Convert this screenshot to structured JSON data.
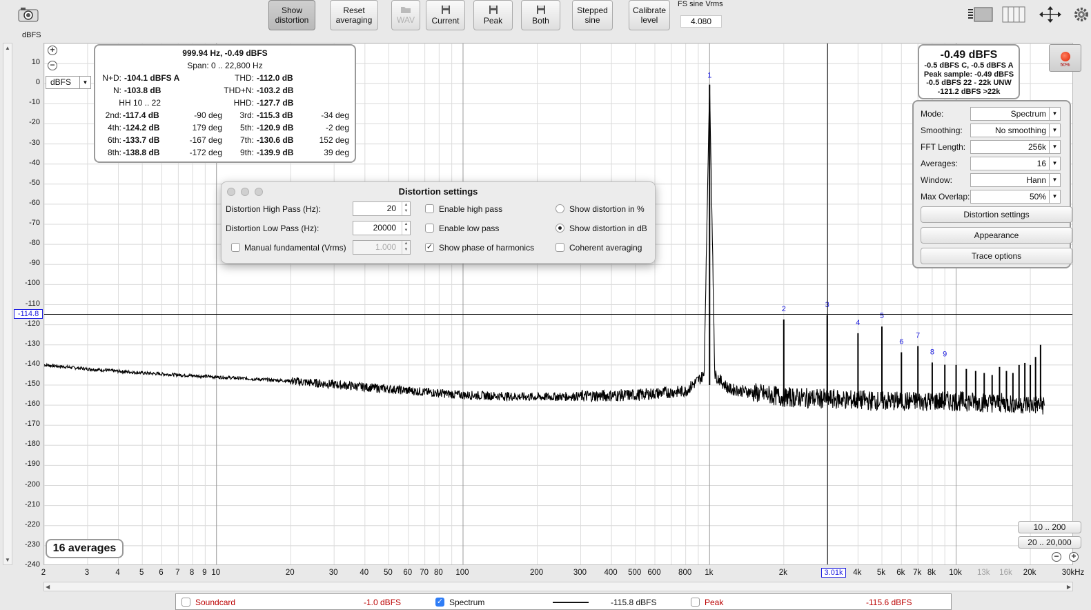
{
  "toolbar": {
    "show_distortion": "Show\ndistortion",
    "reset_averaging": "Reset\naveraging",
    "wav": "WAV",
    "current": "Current",
    "peak": "Peak",
    "both": "Both",
    "stepped_sine": "Stepped\nsine",
    "calibrate_level": "Calibrate\nlevel",
    "fs_sine_label": "FS sine Vrms",
    "fs_sine_value": "4.080"
  },
  "axis": {
    "y_unit": "dBFS",
    "y_ticks": [
      "10",
      "0",
      "-10",
      "-20",
      "-30",
      "-40",
      "-50",
      "-60",
      "-70",
      "-80",
      "-90",
      "-100",
      "-110",
      "-120",
      "-130",
      "-140",
      "-150",
      "-160",
      "-170",
      "-180",
      "-190",
      "-200",
      "-210",
      "-220",
      "-230",
      "-240"
    ],
    "x_ticks": [
      "2",
      "3",
      "4",
      "5",
      "6",
      "7",
      "8",
      "9",
      "10",
      "20",
      "30",
      "40",
      "50",
      "60",
      "70",
      "80",
      "100",
      "200",
      "300",
      "400",
      "500",
      "600",
      "800",
      "1k",
      "2k",
      "4k",
      "5k",
      "6k",
      "7k",
      "8k",
      "10k",
      "13k",
      "16k",
      "20k",
      "30kHz"
    ],
    "x_ticks_grey": [
      "13k",
      "16k"
    ],
    "cursor_y": "-114.8",
    "cursor_x": "3.01k",
    "dbfs_select": "dBFS"
  },
  "info": {
    "header": "999.94 Hz, -0.49 dBFS",
    "span": "Span: 0 .. 22,800 Hz",
    "rows": [
      {
        "l": "N+D:",
        "lv": "-104.1 dBFS A",
        "r": "THD:",
        "rv": "-112.0 dB"
      },
      {
        "l": "N:",
        "lv": "-103.8 dB",
        "r": "THD+N:",
        "rv": "-103.2 dB"
      },
      {
        "l": "HH 10 .. 22",
        "lv": "",
        "r": "HHD:",
        "rv": "-127.7 dB"
      }
    ],
    "harmonics": [
      {
        "n": "2nd:",
        "v": "-117.4 dB",
        "p": "-90 deg",
        "n2": "3rd:",
        "v2": "-115.3 dB",
        "p2": "-34 deg"
      },
      {
        "n": "4th:",
        "v": "-124.2 dB",
        "p": "179 deg",
        "n2": "5th:",
        "v2": "-120.9 dB",
        "p2": "-2 deg"
      },
      {
        "n": "6th:",
        "v": "-133.7 dB",
        "p": "-167 deg",
        "n2": "7th:",
        "v2": "-130.6 dB",
        "p2": "152 deg"
      },
      {
        "n": "8th:",
        "v": "-138.8 dB",
        "p": "-172 deg",
        "n2": "9th:",
        "v2": "-139.9 dB",
        "p2": "39 deg"
      }
    ]
  },
  "dialog": {
    "title": "Distortion settings",
    "hp_label": "Distortion High Pass (Hz):",
    "hp_value": "20",
    "lp_label": "Distortion Low Pass (Hz):",
    "lp_value": "20000",
    "manual_label": "Manual fundamental (Vrms)",
    "manual_value": "1.000",
    "manual_checked": false,
    "enable_hp": "Enable high pass",
    "enable_hp_checked": false,
    "enable_lp": "Enable low pass",
    "enable_lp_checked": false,
    "show_phase": "Show phase of harmonics",
    "show_phase_checked": true,
    "show_pct": "Show distortion in %",
    "show_db": "Show distortion in dB",
    "distortion_unit": "dB",
    "coherent": "Coherent averaging",
    "coherent_checked": false
  },
  "level": {
    "main": "-0.49 dBFS",
    "lines": [
      "-0.5 dBFS C, -0.5 dBFS A",
      "Peak sample: -0.49 dBFS",
      "-0.5 dBFS 22 - 22k UNW",
      "-121.2 dBFS >22k"
    ],
    "rec_pct": "50%"
  },
  "settings": {
    "rows": [
      {
        "label": "Mode:",
        "value": "Spectrum"
      },
      {
        "label": "Smoothing:",
        "value": "No  smoothing"
      },
      {
        "label": "FFT Length:",
        "value": "256k"
      },
      {
        "label": "Averages:",
        "value": "16"
      },
      {
        "label": "Window:",
        "value": "Hann"
      },
      {
        "label": "Max Overlap:",
        "value": "50%"
      }
    ],
    "distortion_settings": "Distortion settings",
    "appearance": "Appearance",
    "trace_options": "Trace options"
  },
  "range": {
    "r1": "10 .. 200",
    "r2": "20 .. 20,000"
  },
  "averages_label": "16 averages",
  "legend": {
    "soundcard": "Soundcard",
    "soundcard_val": "-1.0 dBFS",
    "soundcard_checked": false,
    "spectrum": "Spectrum",
    "spectrum_val": "-115.8 dBFS",
    "spectrum_checked": true,
    "peak": "Peak",
    "peak_val": "-115.6 dBFS",
    "peak_checked": false
  },
  "chart_data": {
    "type": "line",
    "xscale": "log",
    "xlim": [
      2,
      30000
    ],
    "ylim": [
      -240,
      20
    ],
    "ylabel": "dBFS",
    "fundamental": {
      "label": "1",
      "x": 1000,
      "y": -0.49
    },
    "harmonic_markers": [
      {
        "label": "2",
        "x": 2000,
        "y": -117.4
      },
      {
        "label": "3",
        "x": 3000,
        "y": -115.3
      },
      {
        "label": "4",
        "x": 4000,
        "y": -124.2
      },
      {
        "label": "5",
        "x": 5000,
        "y": -120.9
      },
      {
        "label": "6",
        "x": 6000,
        "y": -133.7
      },
      {
        "label": "7",
        "x": 7000,
        "y": -130.6
      },
      {
        "label": "8",
        "x": 8000,
        "y": -138.8
      },
      {
        "label": "9",
        "x": 9000,
        "y": -139.9
      }
    ],
    "extra_harmonics_x": [
      10000,
      11000,
      12000,
      13000,
      14000,
      15000,
      16000,
      17000,
      18000,
      19000,
      20000,
      21000,
      22000
    ],
    "extra_harmonics_y": [
      -140,
      -142,
      -143,
      -144,
      -145,
      -141,
      -143,
      -144,
      -140,
      -139,
      -140,
      -136,
      -130
    ],
    "noise_floor_x": [
      2,
      3,
      5,
      10,
      20,
      50,
      100,
      200,
      500,
      800,
      950,
      1000,
      1050,
      1200,
      2000,
      5000,
      10000,
      22800
    ],
    "noise_floor_y": [
      -140,
      -142,
      -144,
      -146,
      -148,
      -152,
      -155,
      -156,
      -155,
      -153,
      -145,
      -0.49,
      -145,
      -152,
      -156,
      -158,
      -158,
      -160
    ],
    "cursor": {
      "x": 3010,
      "y": -114.8
    }
  }
}
